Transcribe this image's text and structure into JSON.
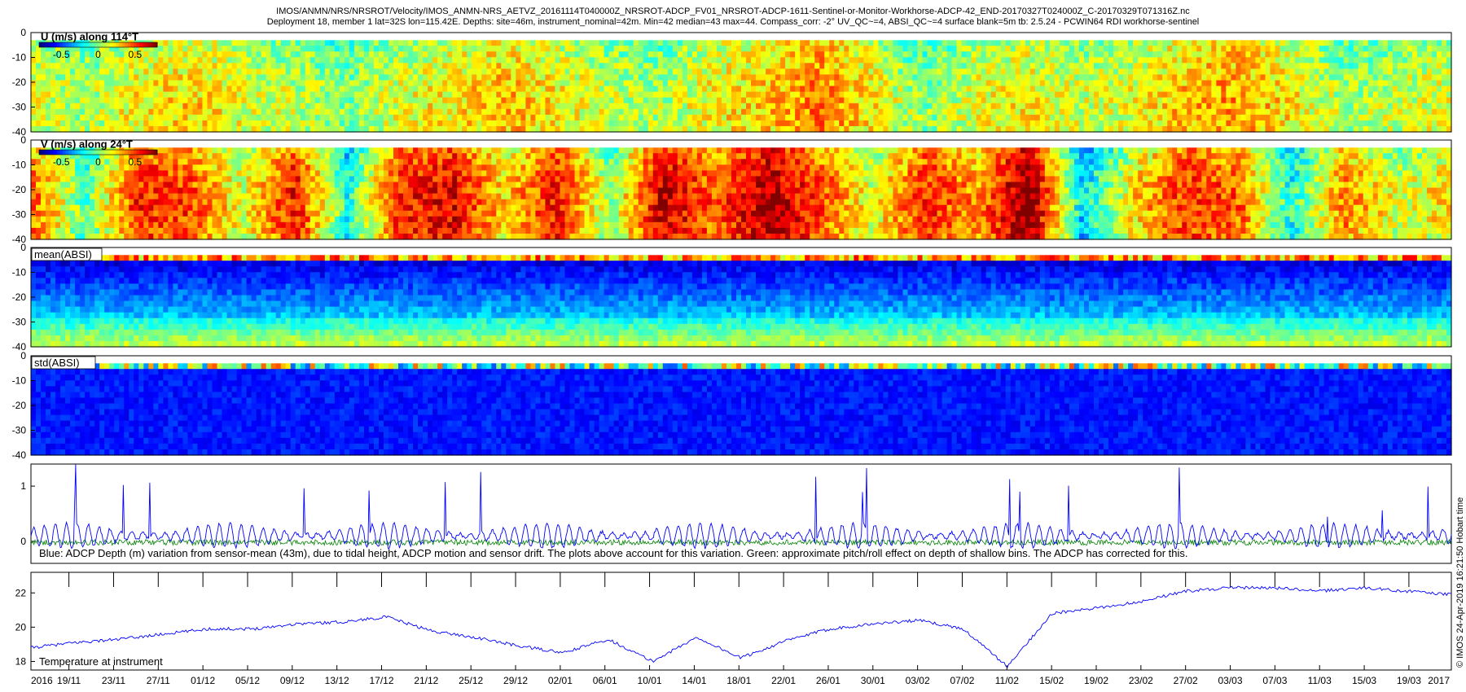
{
  "title_line1": "IMOS/ANMN/NRS/NRSROT/Velocity/IMOS_ANMN-NRS_AETVZ_20161114T040000Z_NRSROT-ADCP_FV01_NRSROT-ADCP-1611-Sentinel-or-Monitor-Workhorse-ADCP-42_END-20170327T024000Z_C-20170329T071316Z.nc",
  "title_line2": "Deployment 18, member 1 lat=32S lon=115.42E. Depths: site=46m, instrument_nominal=42m. Min=42 median=43 max=44. Compass_corr: -2° UV_QC~=4, ABSI_QC~=4 surface blank=5m tb: 2.5.24 - PCWIN64 RDI workhorse-sentinel",
  "side_stamp": "© IMOS 24-Apr-2019 16:21:50 Hobart time",
  "colors": {
    "blue_line": "#0000ff",
    "green_line": "#008000",
    "frame": "#000000"
  },
  "chart_data": [
    {
      "id": "u",
      "type": "heatmap",
      "label": "U (m/s) along 114°T",
      "colormap": "jet",
      "clim": [
        -0.8,
        0.8
      ],
      "colorbar_ticks": [
        "-0.5",
        "0",
        "0.5"
      ],
      "colorbar_tick_values": [
        -0.5,
        0,
        0.5
      ],
      "ylim": [
        -40,
        0
      ],
      "yticks": [
        0,
        -10,
        -20,
        -30,
        -40
      ],
      "grid": false,
      "depth_profile": [
        0.0,
        0.05,
        0.1,
        0.12,
        0.1
      ],
      "time_series": [
        0.05,
        -0.05,
        0.1,
        0.15,
        0.05,
        0.0,
        -0.1,
        0.05,
        0.1,
        0.2,
        0.1,
        0.0,
        -0.05,
        0.1,
        0.15,
        0.3,
        0.1,
        -0.1,
        0.05,
        0.1,
        0.0,
        0.05,
        0.2,
        0.25,
        0.1,
        -0.05,
        0.0,
        0.05
      ]
    },
    {
      "id": "v",
      "type": "heatmap",
      "label": "V (m/s) along 24°T",
      "colormap": "jet",
      "clim": [
        -0.8,
        0.8
      ],
      "colorbar_ticks": [
        "-0.5",
        "0",
        "0.5"
      ],
      "colorbar_tick_values": [
        -0.5,
        0,
        0.5
      ],
      "ylim": [
        -40,
        0
      ],
      "yticks": [
        0,
        -10,
        -20,
        -30,
        -40
      ],
      "grid": false,
      "depth_profile": [
        0.0,
        0.1,
        0.15,
        0.15,
        0.1
      ],
      "time_series": [
        0.3,
        -0.2,
        0.4,
        0.35,
        0.0,
        0.45,
        -0.3,
        0.4,
        0.5,
        0.1,
        0.45,
        -0.1,
        0.55,
        0.3,
        0.6,
        0.35,
        0.0,
        0.4,
        0.2,
        0.7,
        -0.4,
        0.1,
        0.4,
        0.3,
        -0.3,
        0.25,
        0.0,
        0.1
      ]
    },
    {
      "id": "mean_absi",
      "type": "heatmap",
      "label": "mean(ABSI)",
      "colormap": "jet",
      "clim": [
        0,
        1
      ],
      "ylim": [
        -40,
        0
      ],
      "yticks": [
        0,
        -10,
        -20,
        -30,
        -40
      ],
      "grid": false
    },
    {
      "id": "std_absi",
      "type": "heatmap",
      "label": "std(ABSI)",
      "colormap": "jet",
      "clim": [
        0,
        1
      ],
      "ylim": [
        -40,
        0
      ],
      "yticks": [
        0,
        -10,
        -20,
        -30,
        -40
      ],
      "grid": false
    },
    {
      "id": "depth_variation",
      "type": "line",
      "note": "Blue: ADCP Depth (m) variation from sensor-mean (43m), due to tidal height, ADCP motion and sensor drift. The plots above account for this variation. Green: approximate pitch/roll effect on depth of shallow bins. The ADCP has corrected for this.",
      "ylim": [
        -0.4,
        1.4
      ],
      "yticks": [
        1,
        0
      ],
      "grid": false,
      "series": [
        {
          "color": "#0000ff",
          "amplitude": 0.22,
          "spike_max": 1.2
        },
        {
          "color": "#008000",
          "amplitude": 0.05
        }
      ]
    },
    {
      "id": "temperature",
      "type": "line",
      "label": "Temperature at instrument",
      "ylim": [
        17.5,
        23.2
      ],
      "yticks": [
        22,
        20,
        18
      ],
      "grid": false,
      "series": [
        {
          "color": "#0000ff",
          "x": [
            "14/11",
            "19/11",
            "23/11",
            "27/11",
            "01/12",
            "05/12",
            "09/12",
            "13/12",
            "17/12",
            "21/12",
            "25/12",
            "29/12",
            "02/01",
            "06/01",
            "10/01",
            "14/01",
            "18/01",
            "22/01",
            "26/01",
            "30/01",
            "03/02",
            "07/02",
            "11/02",
            "15/02",
            "19/02",
            "23/02",
            "27/02",
            "03/03",
            "07/03",
            "11/03",
            "15/03",
            "19/03",
            "27/03"
          ],
          "y": [
            18.8,
            19.1,
            19.3,
            19.6,
            19.9,
            19.9,
            20.2,
            20.3,
            20.6,
            19.8,
            19.4,
            18.9,
            18.5,
            19.3,
            18.0,
            19.4,
            18.2,
            19.2,
            19.9,
            20.2,
            20.4,
            19.9,
            17.7,
            20.8,
            21.1,
            21.5,
            22.1,
            22.3,
            22.3,
            22.1,
            22.3,
            22.1,
            21.9
          ]
        }
      ]
    }
  ],
  "xaxis": {
    "year_start": "2016",
    "year_end": "2017",
    "ticks": [
      "19/11",
      "23/11",
      "27/11",
      "01/12",
      "05/12",
      "09/12",
      "13/12",
      "17/12",
      "21/12",
      "25/12",
      "29/12",
      "02/01",
      "06/01",
      "10/01",
      "14/01",
      "18/01",
      "22/01",
      "26/01",
      "30/01",
      "03/02",
      "07/02",
      "11/02",
      "15/02",
      "19/02",
      "23/02",
      "27/02",
      "03/03",
      "07/03",
      "11/03",
      "15/03",
      "19/03"
    ]
  }
}
